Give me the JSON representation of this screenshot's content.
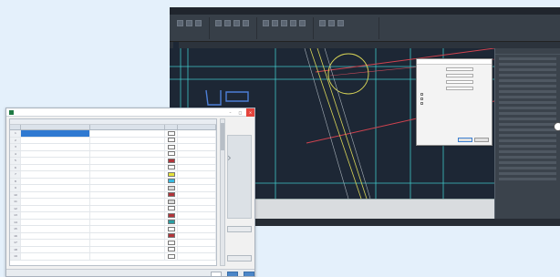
{
  "cad": {
    "title_items": [
      "",
      "",
      "",
      "",
      ""
    ],
    "tabs": [
      "",
      ""
    ],
    "panel_title": "",
    "command_text": "",
    "status_items": [
      "",
      "",
      "",
      "",
      "",
      ""
    ],
    "dialog": {
      "title": "",
      "fields": [
        "",
        "",
        "",
        ""
      ],
      "checks": [
        "",
        "",
        ""
      ],
      "ok": "",
      "cancel": ""
    }
  },
  "sheet": {
    "title": "",
    "caption": "",
    "headers": [
      "",
      "",
      "",
      ""
    ],
    "rows": [
      {
        "n": "1",
        "a": "",
        "b": "",
        "color": "#ffffff",
        "d": ""
      },
      {
        "n": "2",
        "a": "",
        "b": "",
        "color": "#ffffff",
        "d": ""
      },
      {
        "n": "3",
        "a": "",
        "b": "",
        "color": "#ffffff",
        "d": ""
      },
      {
        "n": "4",
        "a": "",
        "b": "",
        "color": "#ffffff",
        "d": ""
      },
      {
        "n": "5",
        "a": "",
        "b": "",
        "color": "#b3343a",
        "d": ""
      },
      {
        "n": "6",
        "a": "",
        "b": "",
        "color": "#ffffff",
        "d": ""
      },
      {
        "n": "7",
        "a": "",
        "b": "",
        "color": "#e5e23b",
        "d": ""
      },
      {
        "n": "8",
        "a": "",
        "b": "",
        "color": "#38b9e0",
        "d": ""
      },
      {
        "n": "9",
        "a": "",
        "b": "",
        "color": "#d8d8d8",
        "d": ""
      },
      {
        "n": "10",
        "a": "",
        "b": "",
        "color": "#b3343a",
        "d": ""
      },
      {
        "n": "11",
        "a": "",
        "b": "",
        "color": "#d8d8d8",
        "d": ""
      },
      {
        "n": "12",
        "a": "",
        "b": "",
        "color": "#ffffff",
        "d": ""
      },
      {
        "n": "13",
        "a": "",
        "b": "",
        "color": "#b3343a",
        "d": ""
      },
      {
        "n": "14",
        "a": "",
        "b": "",
        "color": "#2a9fa3",
        "d": ""
      },
      {
        "n": "15",
        "a": "",
        "b": "",
        "color": "#ffffff",
        "d": ""
      },
      {
        "n": "16",
        "a": "",
        "b": "",
        "color": "#b3343a",
        "d": ""
      },
      {
        "n": "17",
        "a": "",
        "b": "",
        "color": "#ffffff",
        "d": ""
      },
      {
        "n": "18",
        "a": "",
        "b": "",
        "color": "#ffffff",
        "d": ""
      },
      {
        "n": "19",
        "a": "",
        "b": "",
        "color": "#ffffff",
        "d": ""
      }
    ],
    "side_buttons": [
      "",
      ""
    ],
    "bottom_buttons": [
      "",
      "",
      ""
    ]
  },
  "colors": {
    "cad_background": "#1d2735",
    "cad_grid": "#3fc7c7",
    "cad_red_line": "#d0434f",
    "cad_yellow_curve": "#d8d457",
    "selected_cell": "#2f79d1",
    "page_background": "#e4f0fb"
  }
}
